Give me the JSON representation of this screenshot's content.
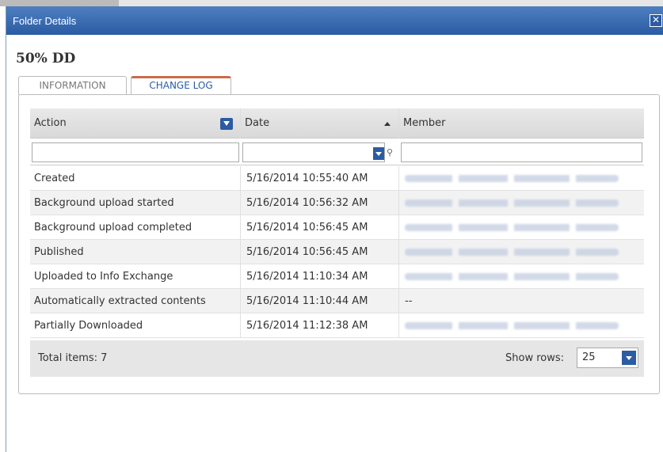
{
  "dialog": {
    "title": "Folder Details",
    "close_glyph": "✕",
    "folder_name": "50% DD"
  },
  "tabs": [
    {
      "label": "INFORMATION",
      "active": false
    },
    {
      "label": "CHANGE LOG",
      "active": true
    }
  ],
  "grid": {
    "columns": {
      "action": "Action",
      "date": "Date",
      "member": "Member"
    },
    "sort": {
      "column": "Date",
      "direction": "ascending"
    },
    "rows": [
      {
        "action": "Created",
        "date": "5/16/2014 10:55:40 AM",
        "member_redacted": true,
        "member": ""
      },
      {
        "action": "Background upload started",
        "date": "5/16/2014 10:56:32 AM",
        "member_redacted": true,
        "member": ""
      },
      {
        "action": "Background upload completed",
        "date": "5/16/2014 10:56:45 AM",
        "member_redacted": true,
        "member": ""
      },
      {
        "action": "Published",
        "date": "5/16/2014 10:56:45 AM",
        "member_redacted": true,
        "member": ""
      },
      {
        "action": "Uploaded to Info Exchange",
        "date": "5/16/2014 11:10:34 AM",
        "member_redacted": true,
        "member": ""
      },
      {
        "action": "Automatically extracted contents",
        "date": "5/16/2014 11:10:44 AM",
        "member_redacted": false,
        "member": "--"
      },
      {
        "action": "Partially Downloaded",
        "date": "5/16/2014 11:12:38 AM",
        "member_redacted": true,
        "member": ""
      }
    ],
    "footer": {
      "total_label": "Total items: 7",
      "show_rows_label": "Show rows:",
      "show_rows_value": "25"
    }
  },
  "icons": {
    "close": "close-icon",
    "column_menu": "chevron-down-icon",
    "sort": "sort-ascending-icon",
    "date_filter_dropdown": "chevron-down-icon",
    "filter": "filter-icon",
    "rows_dropdown": "chevron-down-icon"
  },
  "colors": {
    "titlebar": "#2b5ca3",
    "active_tab_accent": "#c96c4c",
    "button_blue": "#2b5ca3"
  }
}
